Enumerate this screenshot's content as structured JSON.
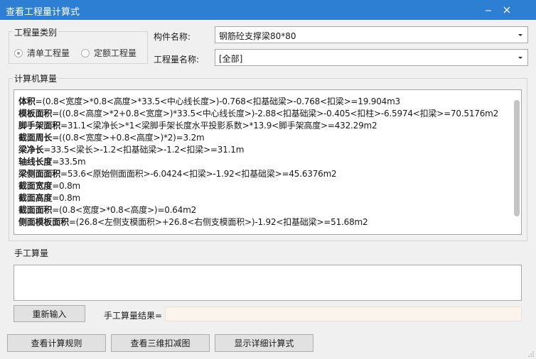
{
  "window": {
    "title": "查看工程量计算式",
    "minimize_icon": "minimize-icon",
    "close_icon": "close-icon"
  },
  "category": {
    "label": "工程量类别",
    "options": [
      {
        "label": "清单工程量",
        "checked": true
      },
      {
        "label": "定额工程量",
        "checked": false
      }
    ]
  },
  "component": {
    "label": "构件名称:",
    "value": "钢筋砼支撑梁80*80"
  },
  "quantity": {
    "label": "工程量名称:",
    "value": "[全部]"
  },
  "computer_calc": {
    "label": "计算机算量",
    "lines": [
      {
        "name": "体积",
        "expr": "=(0.8<宽度>*0.8<高度>*33.5<中心线长度>)-0.768<扣基础梁>-0.768<扣梁>=19.904m3"
      },
      {
        "name": "模板面积",
        "expr": "=((0.8<高度>*2+0.8<宽度>)*33.5<中心线长度>)-2.88<扣基础梁>-0.405<扣柱>-6.5974<扣梁>=70.5176m2"
      },
      {
        "name": "脚手架面积",
        "expr": "=31.1<梁净长>*1<梁脚手架长度水平投影系数>*13.9<脚手架高度>=432.29m2"
      },
      {
        "name": "截面周长",
        "expr": "=((0.8<宽度>+0.8<高度>)*2)=3.2m"
      },
      {
        "name": "梁净长",
        "expr": "=33.5<梁长>-1.2<扣基础梁>-1.2<扣梁>=31.1m"
      },
      {
        "name": "轴线长度",
        "expr": "=33.5m"
      },
      {
        "name": "梁侧面面积",
        "expr": "=53.6<原始侧面面积>-6.0424<扣梁>-1.92<扣基础梁>=45.6376m2"
      },
      {
        "name": "截面宽度",
        "expr": "=0.8m"
      },
      {
        "name": "截面高度",
        "expr": "=0.8m"
      },
      {
        "name": "截面面积",
        "expr": "=(0.8<宽度>*0.8<高度>)=0.64m2"
      },
      {
        "name": "侧面模板面积",
        "expr": "=(26.8<左侧支模面积>+26.8<右侧支模面积>)-1.92<扣基础梁>=51.68m2"
      }
    ]
  },
  "manual_calc": {
    "label": "手工算量",
    "value": ""
  },
  "buttons": {
    "reenter": "重新输入",
    "view_rules": "查看计算规则",
    "view_3d": "查看三维扣减图",
    "show_detail": "显示详细计算式"
  },
  "manual_result": {
    "label": "手工算量结果=",
    "value": ""
  }
}
